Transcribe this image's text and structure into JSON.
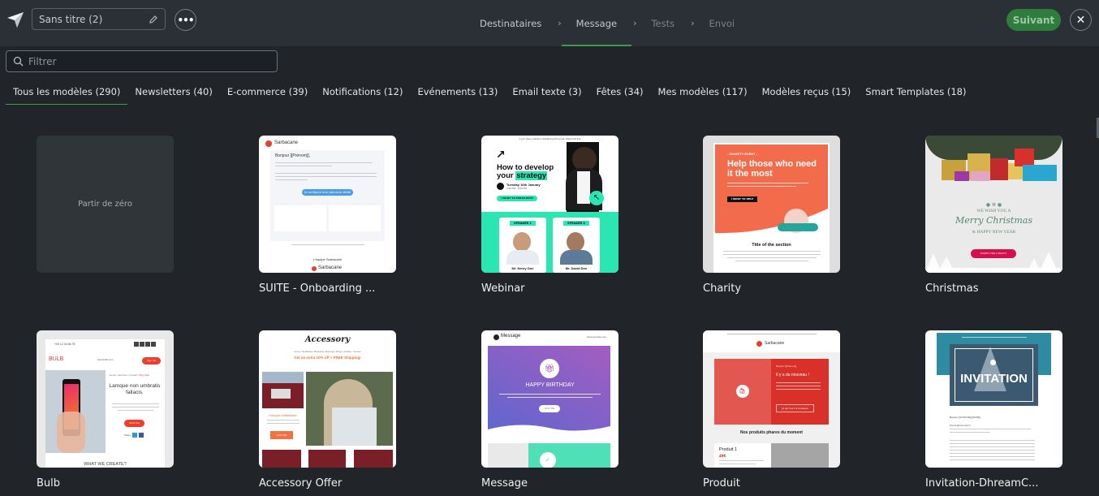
{
  "header": {
    "document_title": "Sans titre (2)",
    "more_label": "•••",
    "steps": [
      {
        "label": "Destinataires",
        "state": "done"
      },
      {
        "label": "Message",
        "state": "active"
      },
      {
        "label": "Tests",
        "state": "pending"
      },
      {
        "label": "Envoi",
        "state": "pending"
      }
    ],
    "step_separator": "›",
    "next_label": "Suivant",
    "close_label": "✕",
    "accent_color": "#2f7d3e"
  },
  "filter": {
    "placeholder": "Filtrer",
    "value": ""
  },
  "tabs": [
    {
      "label": "Tous les modèles (290)",
      "active": true
    },
    {
      "label": "Newsletters (40)"
    },
    {
      "label": "E-commerce (39)"
    },
    {
      "label": "Notifications (12)"
    },
    {
      "label": "Evénements (13)"
    },
    {
      "label": "Email texte (3)"
    },
    {
      "label": "Fêtes (34)"
    },
    {
      "label": "Mes modèles (117)"
    },
    {
      "label": "Modèles reçus (15)"
    },
    {
      "label": "Smart Templates (18)"
    }
  ],
  "templates": {
    "blank_label": "Partir de zéro",
    "items": [
      {
        "name": "SUITE - Onboarding ...",
        "preview": {
          "brand": "Sarbacane",
          "greeting": "Bonjour [[Prénom]],",
          "cta": "Je configure mon domaine dédié",
          "closing": "L'équipe Sarbacane"
        }
      },
      {
        "name": "Webinar",
        "preview": {
          "top_note": "If you have problems displaying this email, follow this link",
          "headline_1": "How to develop",
          "headline_2": "your",
          "headline_highlight": "strategy",
          "date": "Tuesday 10th January",
          "time": "4:30 PM - 5:00 PM",
          "cta": "I WANT TO PARTICIPATE",
          "speaker_1_tag": "SPEAKER 1",
          "speaker_1_name": "Mr. Henry Doe",
          "speaker_2_tag": "SPEAKER 2",
          "speaker_2_name": "Mr. David Doe"
        }
      },
      {
        "name": "Charity",
        "preview": {
          "kicker": "- CHARITY EVENT -",
          "headline": "Help those who need it the most",
          "cta": "I WANT TO HELP",
          "section_title": "Title of the section"
        }
      },
      {
        "name": "Christmas",
        "preview": {
          "line_1": "WE WISH YOU A",
          "line_2": "Merry Christmas",
          "line_3": "& HAPPY NEW YEAR",
          "cta": "HAPPY HOLLIDAYS"
        }
      },
      {
        "name": "Bulb",
        "preview": {
          "phone": "+00 12 34 56 78",
          "brand": "BULB",
          "site": "www.bulb.com",
          "signup": "Sign Up",
          "headline": "Lamque non umbratis fallacis.",
          "cta": "Click me",
          "share": "Share",
          "section": "WHAT WE CREATE?"
        }
      },
      {
        "name": "Accessory Offer",
        "preview": {
          "brand": "Accessory",
          "nav": "Home / Necklaces / Bracelets / Earrings / Rings / Anklets / Contact",
          "offer": "Get an extra 10% off + FREE Shipping!",
          "product_title": "Hasque adfabilitate",
          "cta": "Click Me"
        }
      },
      {
        "name": "Message",
        "preview": {
          "brand": "Message",
          "site": "www.yoursite.com",
          "headline": "HAPPY BIRTHDAY",
          "cta": "Click Me"
        }
      },
      {
        "name": "Produit",
        "preview": {
          "brand": "Sarbacane",
          "greeting": "Bonjour [[Prénom]],",
          "headline": "Il y a du nouveau !",
          "cta": "Je parcours la boutique",
          "section": "Nos produits phares du moment",
          "product": "Produit 1",
          "price": "49€"
        }
      },
      {
        "name": "Invitation-DhreamC...",
        "preview": {
          "headline": "INVITATION",
          "greeting": "Bonjour [[CIVILITE]] [[NOM]],",
          "intro": "Tout d'abord merci !"
        }
      }
    ]
  }
}
